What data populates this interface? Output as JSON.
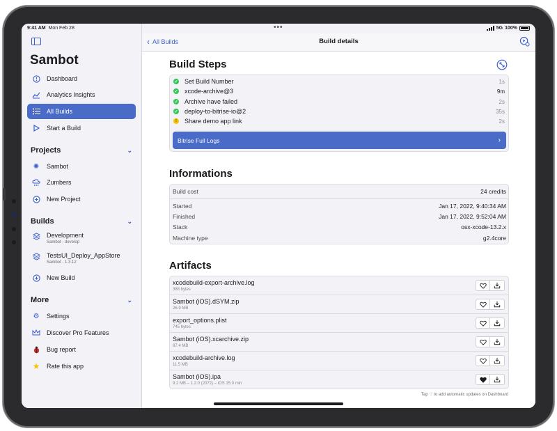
{
  "status_bar": {
    "time": "9:41 AM",
    "date": "Mon Feb 28",
    "network": "5G",
    "battery": "100%"
  },
  "sidebar": {
    "app_title": "Sambot",
    "main_items": [
      {
        "label": "Dashboard",
        "icon": "gauge-icon"
      },
      {
        "label": "Analytics Insights",
        "icon": "chart-icon"
      },
      {
        "label": "All Builds",
        "icon": "list-icon",
        "active": true
      },
      {
        "label": "Start a Build",
        "icon": "play-icon"
      }
    ],
    "projects": {
      "title": "Projects",
      "items": [
        {
          "label": "Sambot",
          "icon": "sun-icon"
        },
        {
          "label": "Zumbers",
          "icon": "cloud-rain-icon"
        },
        {
          "label": "New Project",
          "icon": "plus-circle-icon"
        }
      ]
    },
    "builds": {
      "title": "Builds",
      "items": [
        {
          "label": "Development",
          "sub": "Sambot - develop",
          "icon": "layers-icon"
        },
        {
          "label": "TestsUI_Deploy_AppStore",
          "sub": "Sambot - 1.3.12",
          "icon": "layers-icon"
        },
        {
          "label": "New Build",
          "icon": "plus-circle-icon"
        }
      ]
    },
    "more": {
      "title": "More",
      "items": [
        {
          "label": "Settings",
          "icon": "gear-icon"
        },
        {
          "label": "Discover Pro Features",
          "icon": "crown-icon"
        },
        {
          "label": "Bug report",
          "icon": "ladybug-icon"
        },
        {
          "label": "Rate this app",
          "icon": "star-icon"
        }
      ]
    }
  },
  "navbar": {
    "back_label": "All Builds",
    "title": "Build details"
  },
  "build_steps": {
    "title": "Build Steps",
    "steps": [
      {
        "name": "Set Build Number",
        "duration": "1s",
        "status": "success"
      },
      {
        "name": "xcode-archive@3",
        "duration": "9m",
        "status": "success"
      },
      {
        "name": "Archive have failed",
        "duration": "2s",
        "status": "success"
      },
      {
        "name": "deploy-to-bitrise-io@2",
        "duration": "35s",
        "status": "success"
      },
      {
        "name": "Share demo app link",
        "duration": "2s",
        "status": "warning"
      }
    ],
    "logs_button": "Bitrise Full Logs"
  },
  "informations": {
    "title": "Informations",
    "build_cost": {
      "label": "Build cost",
      "value": "24 credits"
    },
    "rows": [
      {
        "label": "Started",
        "value": "Jan 17, 2022, 9:40:34 AM"
      },
      {
        "label": "Finished",
        "value": "Jan 17, 2022, 9:52:04 AM"
      },
      {
        "label": "Stack",
        "value": "osx-xcode-13.2.x"
      },
      {
        "label": "Machine type",
        "value": "g2.4core"
      }
    ]
  },
  "artifacts": {
    "title": "Artifacts",
    "items": [
      {
        "name": "xcodebuild-export-archive.log",
        "meta": "388 bytes",
        "favorited": false
      },
      {
        "name": "Sambot (iOS).dSYM.zip",
        "meta": "26.9 MB",
        "favorited": false
      },
      {
        "name": "export_options.plist",
        "meta": "745 bytes",
        "favorited": false
      },
      {
        "name": "Sambot (iOS).xcarchive.zip",
        "meta": "87.4 MB",
        "favorited": false
      },
      {
        "name": "xcodebuild-archive.log",
        "meta": "11.5 MB",
        "favorited": false
      },
      {
        "name": "Sambot (iOS).ipa",
        "meta": "9.2 MB – 1.2.0 (2072) – iOS 15.0 min",
        "favorited": true
      }
    ],
    "footer_note": "Tap ♡ to add automatic updates on Dashboard"
  },
  "colors": {
    "accent": "#3a5fcd",
    "active_bg": "#4a6bc7",
    "success": "#34c759",
    "warning": "#ffcc00"
  }
}
